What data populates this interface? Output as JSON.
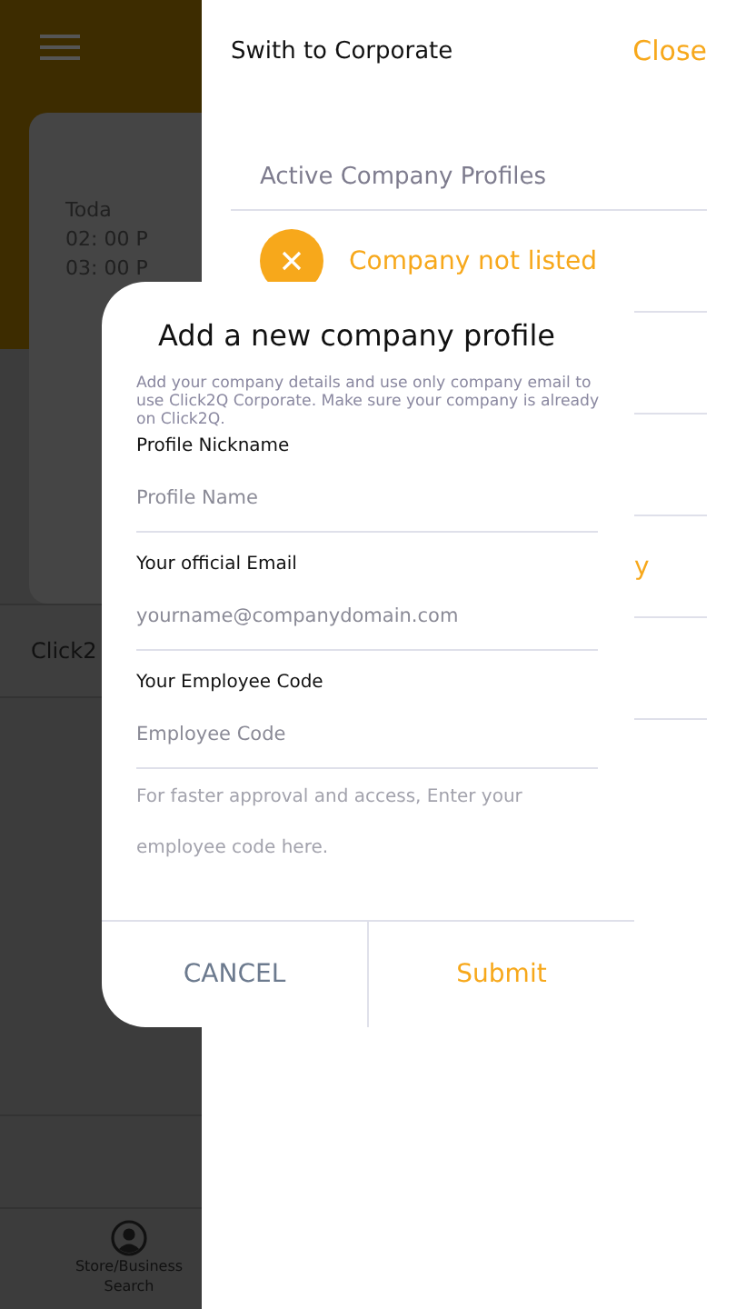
{
  "background": {
    "card_lines": [
      "Toda",
      "02: 00 P",
      "03: 00 P"
    ],
    "list_item": "Click2",
    "bottom_nav": [
      {
        "label": "Store/Business Search",
        "kind": "person"
      }
    ]
  },
  "drawer": {
    "title": "Swith to Corporate",
    "close": "Close",
    "section": "Active Company Profiles",
    "rows": [
      {
        "kind": "add",
        "label": "Company not listed"
      },
      {
        "kind": "blank"
      },
      {
        "kind": "blank"
      },
      {
        "kind": "tail",
        "label": "y"
      },
      {
        "kind": "blank"
      }
    ]
  },
  "dialog": {
    "title": "Add a new company profile",
    "description": "Add your company details and use only company email to use Click2Q Corporate. Make sure your company is already on Click2Q.",
    "fields": [
      {
        "label": "Profile Nickname",
        "placeholder": "Profile Name"
      },
      {
        "label": "Your official Email",
        "placeholder": "yourname@companydomain.com"
      },
      {
        "label": "Your Employee Code",
        "placeholder": "Employee Code"
      }
    ],
    "hint": "For faster approval and access, Enter your employee code here.",
    "buttons": [
      {
        "label": "CANCEL",
        "kind": "secondary"
      },
      {
        "label": "Submit",
        "kind": "primary"
      }
    ]
  }
}
